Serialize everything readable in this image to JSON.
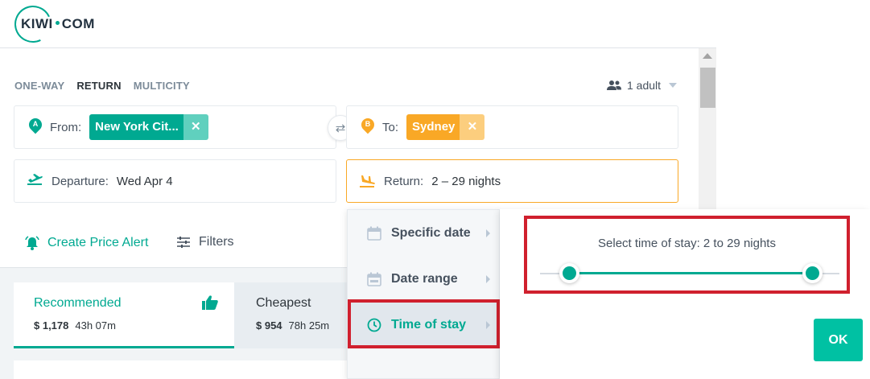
{
  "brand": {
    "logo_text_left": "KIWI",
    "logo_text_right": "COM",
    "accent": "#00a991",
    "secondary": "#f9a826"
  },
  "search": {
    "trip_types": [
      {
        "label": "ONE-WAY",
        "active": false
      },
      {
        "label": "RETURN",
        "active": true
      },
      {
        "label": "MULTICITY",
        "active": false
      }
    ],
    "passengers": {
      "label": "1 adult",
      "icon": "passengers-icon"
    },
    "from": {
      "label": "From:",
      "pin_letter": "A",
      "chip": "New York Cit..."
    },
    "to": {
      "label": "To:",
      "pin_letter": "B",
      "chip": "Sydney"
    },
    "departure": {
      "label": "Departure:",
      "value": "Wed Apr 4"
    },
    "return": {
      "label": "Return:",
      "value": "2 – 29 nights"
    }
  },
  "actions": {
    "price_alert": "Create Price Alert",
    "filters": "Filters"
  },
  "sort_tabs": [
    {
      "title": "Recommended",
      "price": "$ 1,178",
      "duration": "43h 07m",
      "icon": "thumbs-up-icon"
    },
    {
      "title": "Cheapest",
      "price": "$ 954",
      "duration": "78h 25m"
    }
  ],
  "return_menu": {
    "items": [
      {
        "label": "Specific date",
        "icon": "calendar-icon"
      },
      {
        "label": "Date range",
        "icon": "calendar-range-icon"
      },
      {
        "label": "Time of stay",
        "icon": "clock-icon",
        "selected": true
      }
    ]
  },
  "time_of_stay": {
    "title": "Select time of stay: 2 to 29 nights",
    "min_nights": 2,
    "max_nights": 29,
    "ok_label": "OK"
  }
}
